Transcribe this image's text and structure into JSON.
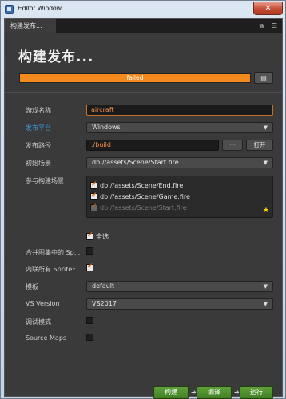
{
  "window": {
    "title": "Editor Window",
    "close_label": "✕"
  },
  "tab": {
    "label": "构建发布..."
  },
  "page": {
    "title": "构建发布..."
  },
  "build_status": {
    "text": "failed",
    "progress": 1.0,
    "color": "#f28a1e",
    "log_icon": "log-icon"
  },
  "form": {
    "game_name_label": "游戏名称",
    "game_name_value": "aircraft",
    "platform_label": "发布平台",
    "platform_value": "Windows",
    "build_path_label": "发布路径",
    "build_path_value": "./build",
    "browse_label": "···",
    "open_label": "打开",
    "start_scene_label": "初始场景",
    "start_scene_value": "db://assets/Scene/Start.fire",
    "included_scenes_label": "参与构建场景",
    "scenes": [
      {
        "path": "db://assets/Scene/End.fire",
        "checked": true,
        "disabled": false
      },
      {
        "path": "db://assets/Scene/Game.fire",
        "checked": true,
        "disabled": false
      },
      {
        "path": "db://assets/Scene/Start.fire",
        "checked": true,
        "disabled": true
      }
    ],
    "select_all_label": "全选",
    "merge_atlas_label": "合并图集中的 Sp...",
    "inline_sprite_label": "内联所有 SpriteF...",
    "template_label": "模板",
    "template_value": "default",
    "vs_version_label": "VS Version",
    "vs_version_value": "VS2017",
    "debug_label": "调试模式",
    "source_maps_label": "Source Maps"
  },
  "actions": {
    "build": "构建",
    "compile": "编译",
    "run": "运行"
  },
  "colors": {
    "accent": "#3d9fe0",
    "primary_button": "#4f8f2e",
    "progress": "#f28a1e"
  }
}
